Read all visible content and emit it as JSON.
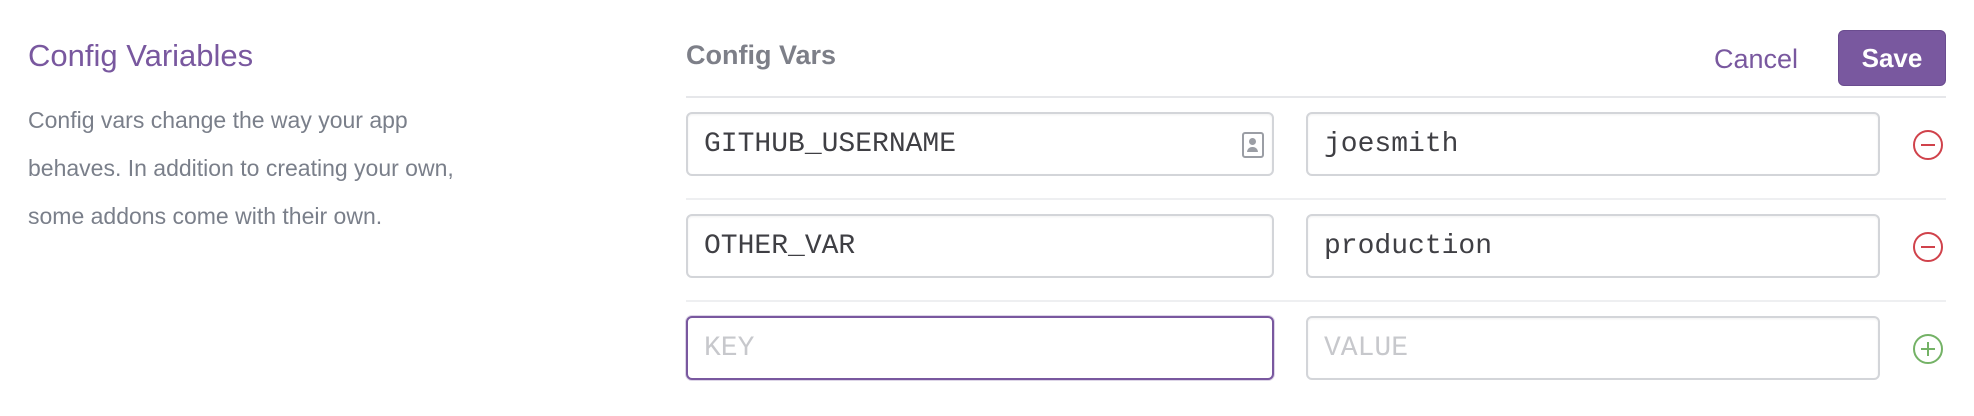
{
  "intro": {
    "title": "Config Variables",
    "description": "Config vars change the way your app behaves. In addition to creating your own, some addons come with their own."
  },
  "panel": {
    "title": "Config Vars",
    "cancel_label": "Cancel",
    "save_label": "Save",
    "rows": [
      {
        "key": "GITHUB_USERNAME",
        "value": "joesmith",
        "action": "remove"
      },
      {
        "key": "OTHER_VAR",
        "value": "production",
        "action": "remove"
      }
    ],
    "new_row": {
      "key_placeholder": "KEY",
      "value_placeholder": "VALUE",
      "action": "add"
    }
  },
  "colors": {
    "accent": "#79589f",
    "remove": "#d0424b",
    "add": "#74b266"
  },
  "icons": {
    "key_field_icon": "contact-card-icon",
    "remove": "minus-circle-icon",
    "add": "plus-circle-icon"
  }
}
